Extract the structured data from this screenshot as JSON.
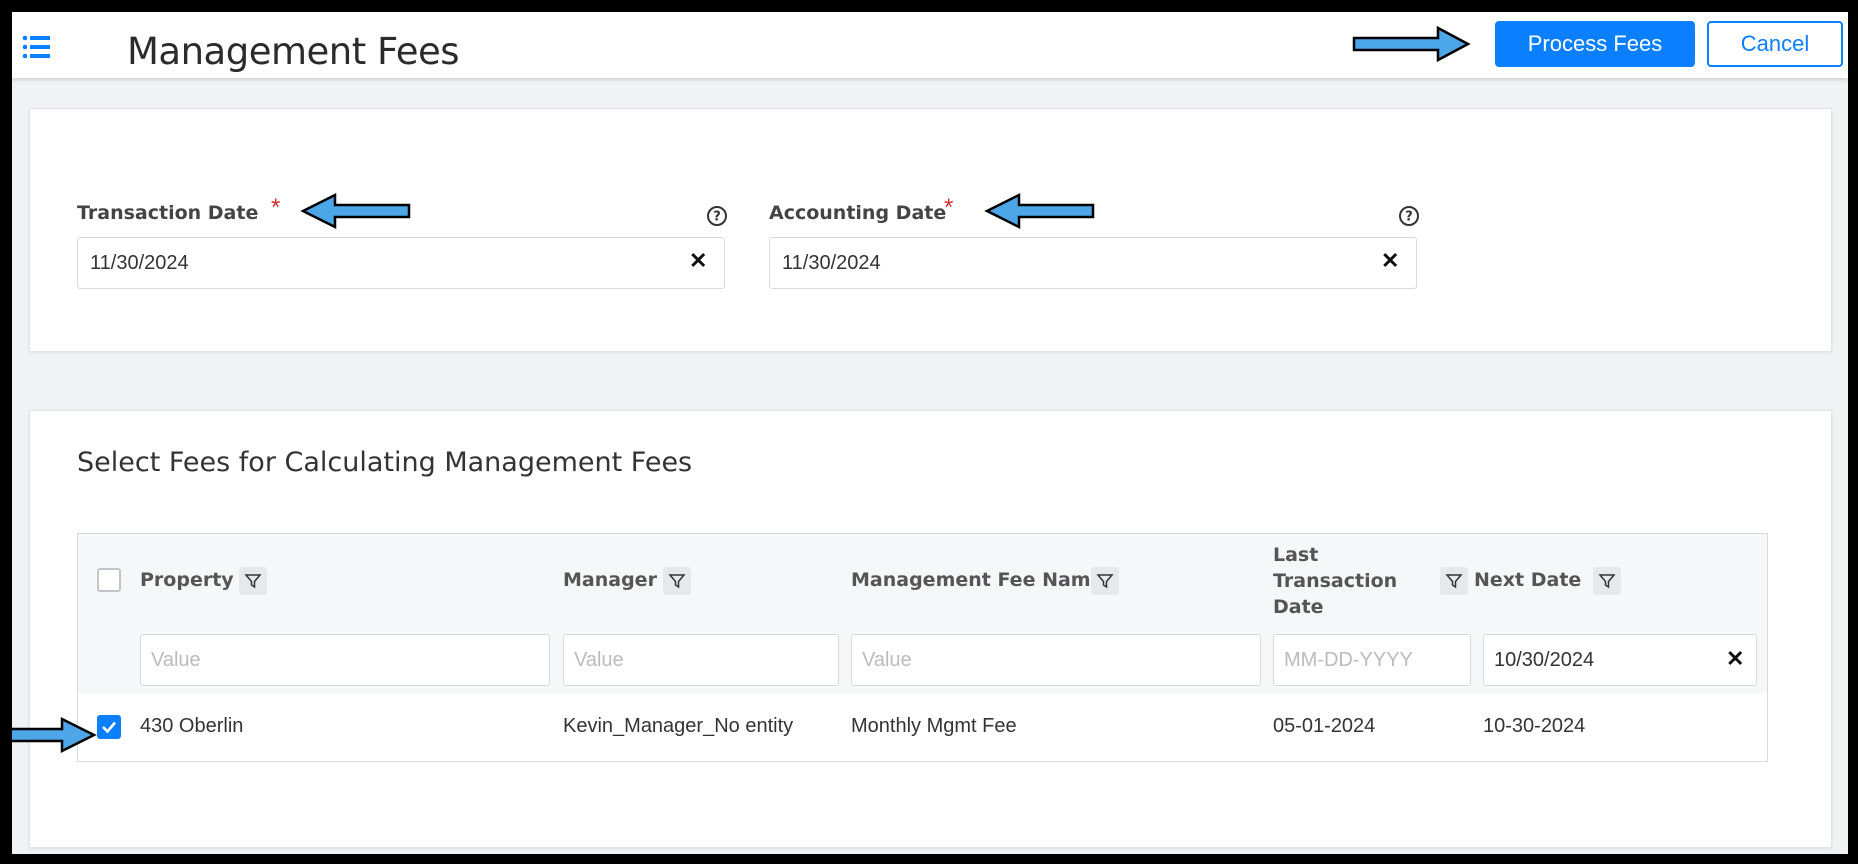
{
  "header": {
    "title": "Management Fees",
    "process_label": "Process Fees",
    "cancel_label": "Cancel"
  },
  "dates": {
    "transaction_label": "Transaction Date",
    "transaction_value": "11/30/2024",
    "accounting_label": "Accounting Date",
    "accounting_value": "11/30/2024",
    "required_mark": "*"
  },
  "fees": {
    "title": "Select Fees for Calculating Management Fees",
    "columns": {
      "property": "Property",
      "manager": "Manager",
      "fee_name": "Management Fee Name",
      "last_date": "Last Transaction Date",
      "next_date": "Next Date"
    },
    "filters": {
      "property_placeholder": "Value",
      "manager_placeholder": "Value",
      "fee_name_placeholder": "Value",
      "last_date_placeholder": "MM-DD-YYYY",
      "next_date_value": "10/30/2024"
    },
    "rows": [
      {
        "checked": true,
        "property": "430 Oberlin",
        "manager": "Kevin_Manager_No entity",
        "fee_name": "Monthly Mgmt Fee",
        "last_date": "05-01-2024",
        "next_date": "10-30-2024"
      }
    ]
  },
  "icons": {
    "menu": "list-menu-icon",
    "help": "question-circle-icon",
    "clear": "close-icon",
    "filter": "funnel-filter-icon",
    "arrow": "annotation-arrow-icon"
  },
  "colors": {
    "primary": "#0a7fff",
    "required": "#d32f2f",
    "arrow_fill": "#4da6e8"
  }
}
